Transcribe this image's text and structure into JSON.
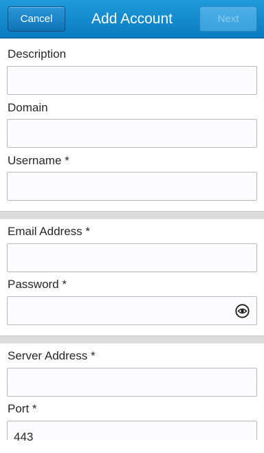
{
  "header": {
    "title": "Add Account",
    "cancel_label": "Cancel",
    "next_label": "Next"
  },
  "fields": {
    "description": {
      "label": "Description",
      "value": ""
    },
    "domain": {
      "label": "Domain",
      "value": ""
    },
    "username": {
      "label": "Username *",
      "value": ""
    },
    "email": {
      "label": "Email Address *",
      "value": ""
    },
    "password": {
      "label": "Password *",
      "value": "",
      "icon": "eye-icon"
    },
    "server": {
      "label": "Server Address *",
      "value": ""
    },
    "port": {
      "label": "Port *",
      "value": "443"
    }
  },
  "colors": {
    "header": "#0a7bc0",
    "divider": "#dcdcdc"
  }
}
